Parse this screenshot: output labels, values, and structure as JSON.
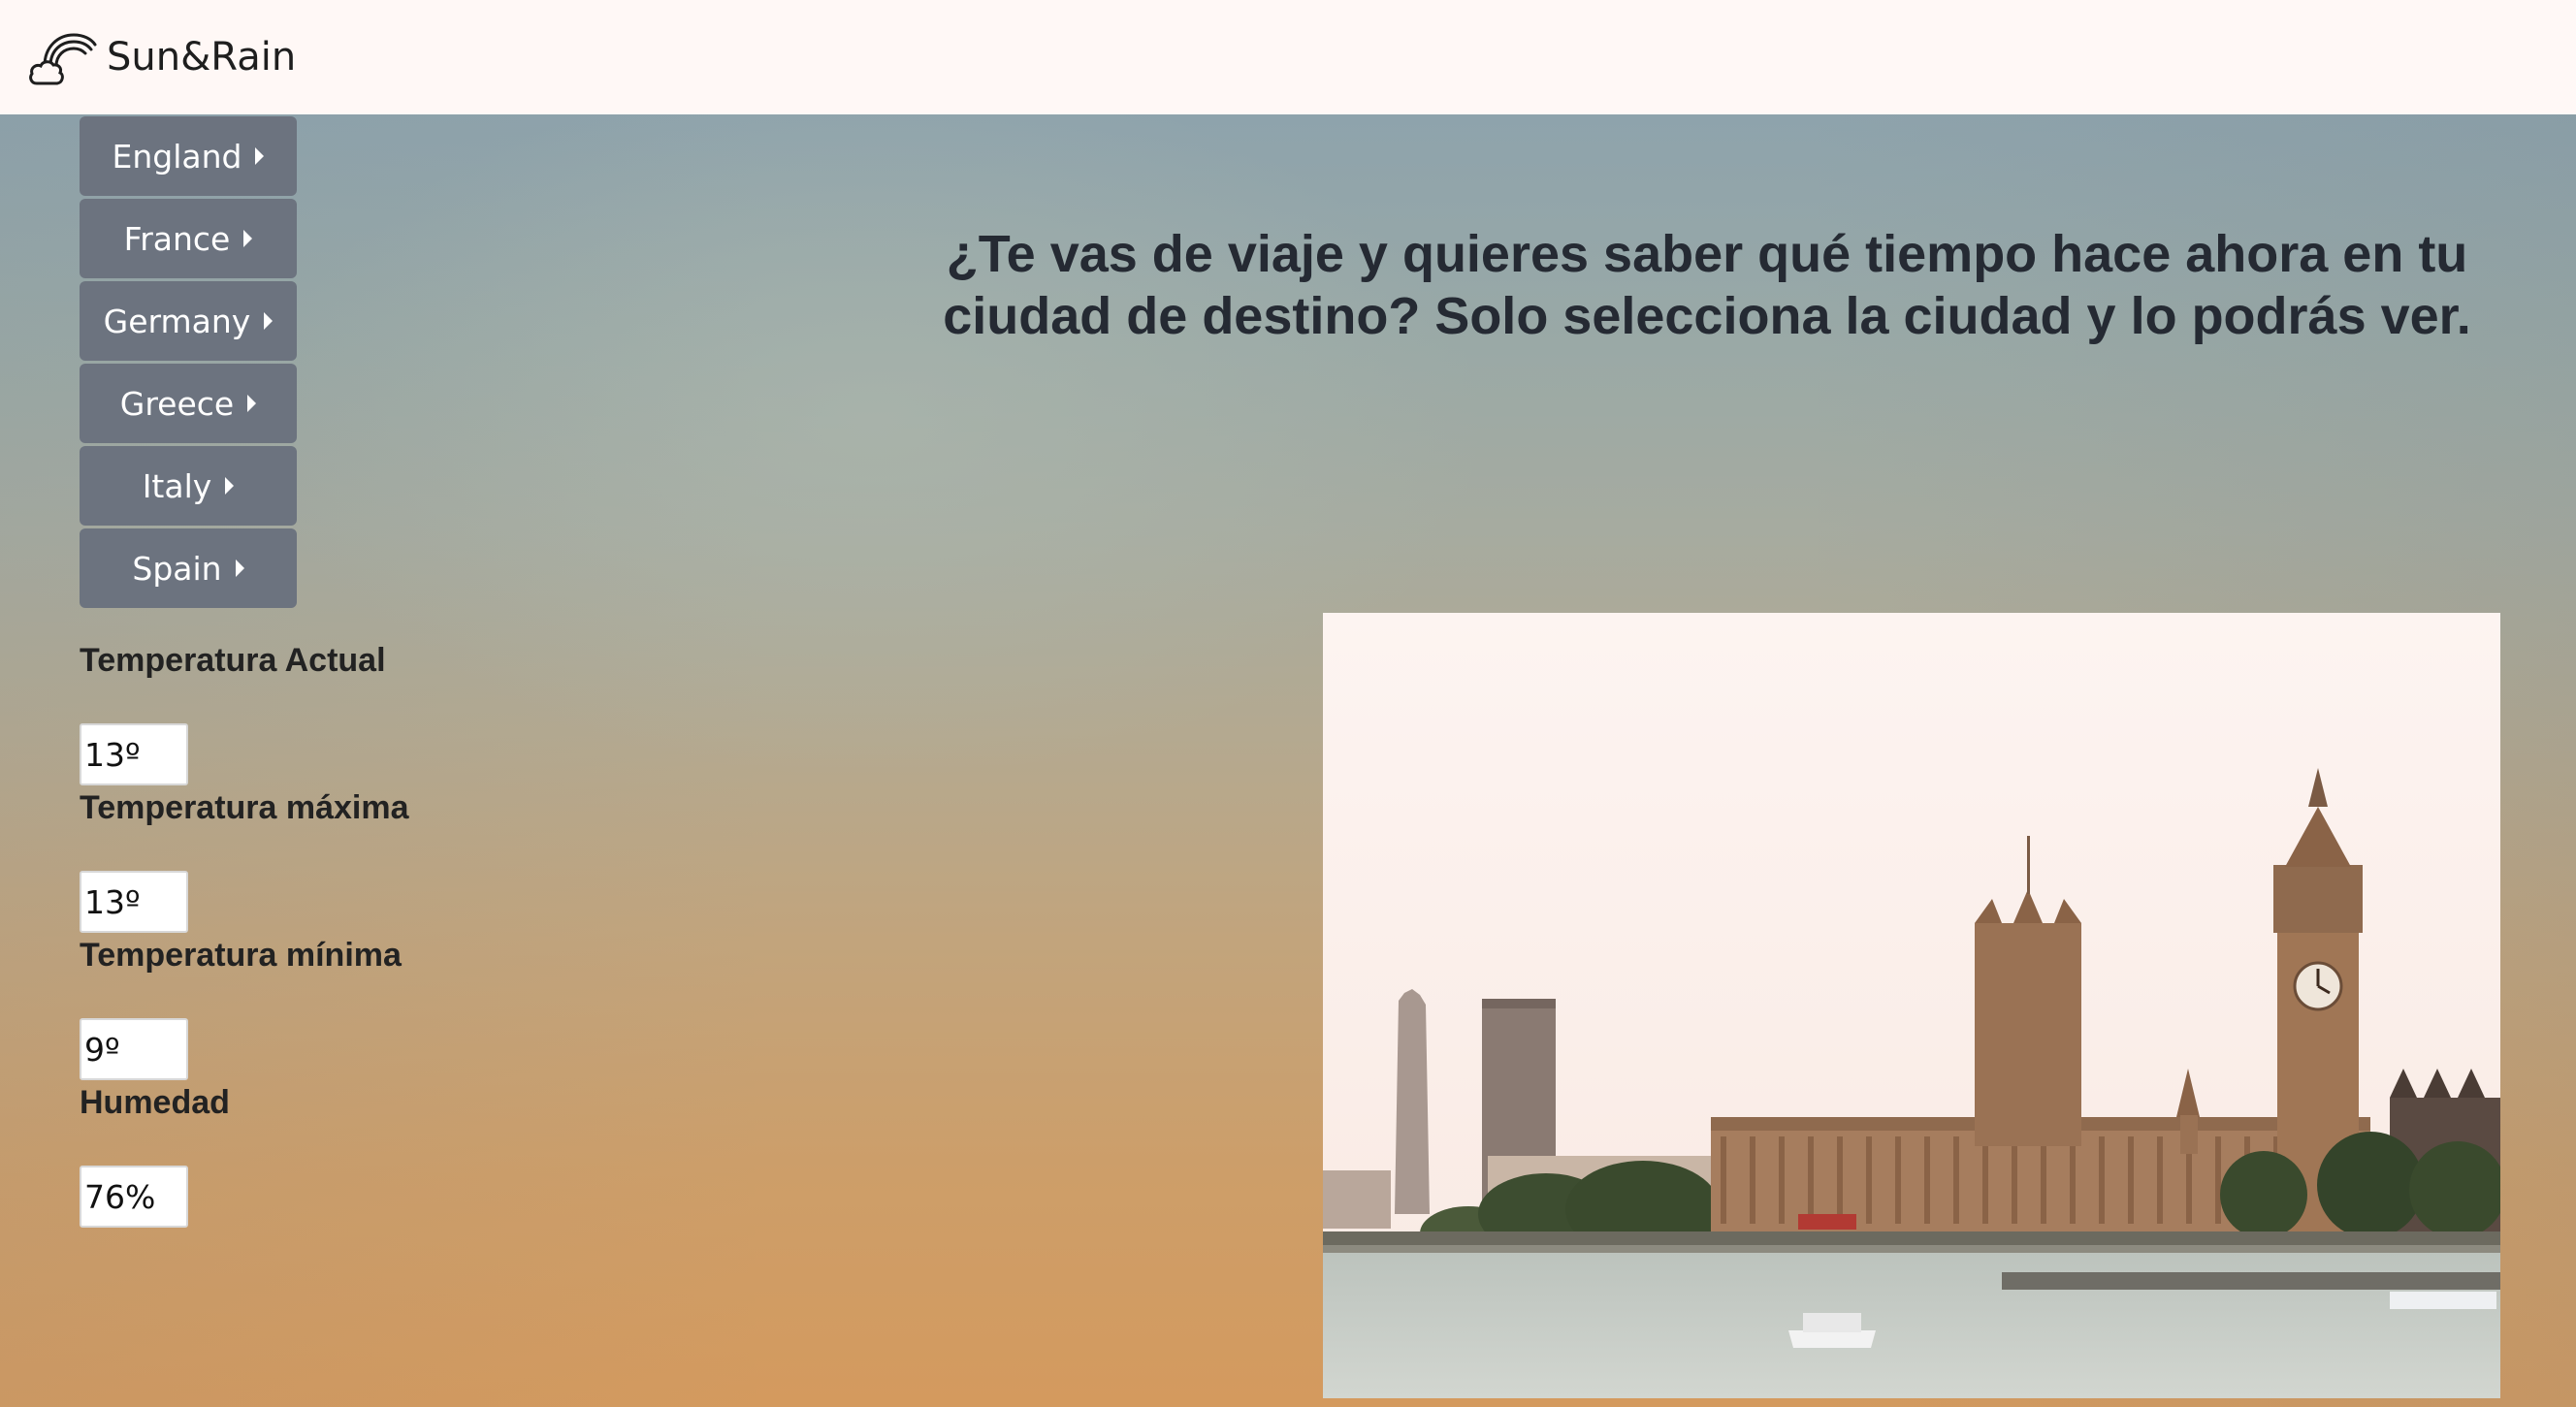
{
  "brand": {
    "name": "Sun&Rain",
    "icon": "rainbow-cloud-icon"
  },
  "countries": [
    {
      "label": "England"
    },
    {
      "label": "France"
    },
    {
      "label": "Germany"
    },
    {
      "label": "Greece"
    },
    {
      "label": "Italy"
    },
    {
      "label": "Spain"
    }
  ],
  "headline": "¿Te vas de viaje y quieres saber qué tiempo hace ahora en tu ciudad de destino? Solo selecciona la ciudad y lo podrás ver.",
  "weather": {
    "current_label": "Temperatura Actual",
    "current_value": "13º",
    "max_label": "Temperatura máxima",
    "max_value": "13º",
    "min_label": "Temperatura mínima",
    "min_value": "9º",
    "humidity_label": "Humedad",
    "humidity_value": "76%"
  },
  "colors": {
    "navbar_bg": "#fff8f6",
    "menu_button_bg": "#6c737f",
    "headline_text": "#252a33"
  }
}
